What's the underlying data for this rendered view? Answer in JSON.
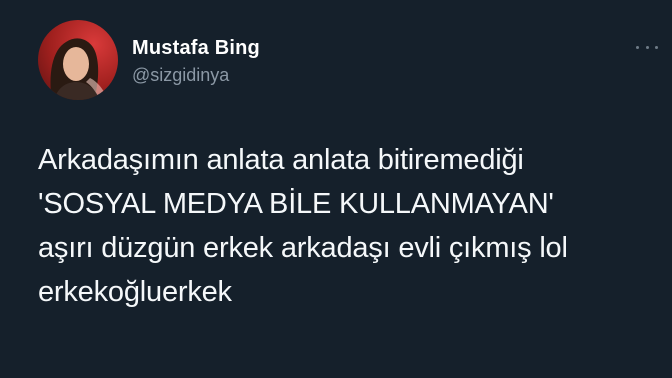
{
  "tweet": {
    "author": {
      "display_name": "Mustafa Bing",
      "handle": "@sizgidinya",
      "avatar_icon": "user-avatar"
    },
    "more_icon": "more-horizontal-icon",
    "text_lines": [
      "Arkadaşımın anlata anlata bitiremediği",
      "'SOSYAL MEDYA BİLE KULLANMAYAN'",
      "aşırı düzgün erkek arkadaşı evli çıkmış lol",
      "erkekoğluerkek"
    ]
  },
  "colors": {
    "background": "#15202b",
    "text": "#f5f8fa",
    "handle": "#8b98a5"
  }
}
